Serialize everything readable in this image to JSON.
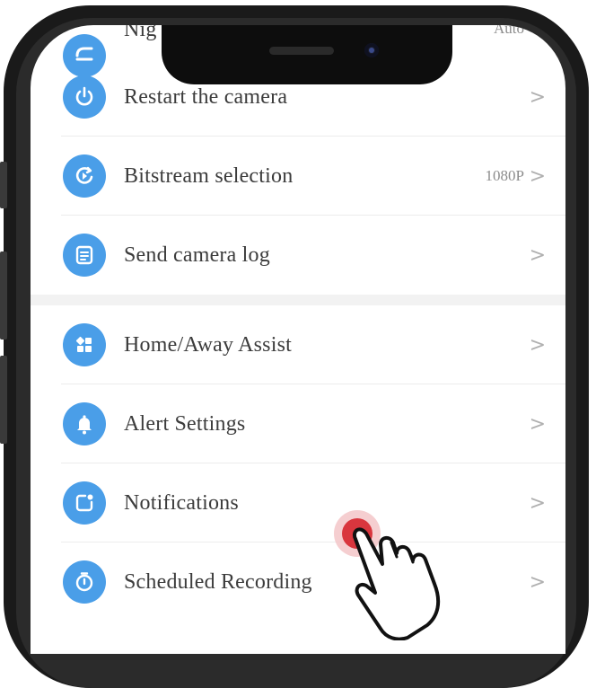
{
  "menu": {
    "items": [
      {
        "label": "Nig",
        "value": "Auto",
        "icon": "night-mode-icon"
      },
      {
        "label": "Restart the camera",
        "value": "",
        "icon": "power-icon"
      },
      {
        "label": "Bitstream selection",
        "value": "1080P",
        "icon": "bitstream-icon"
      },
      {
        "label": "Send camera log",
        "value": "",
        "icon": "log-document-icon"
      },
      {
        "label": "Home/Away Assist",
        "value": "",
        "icon": "home-away-icon"
      },
      {
        "label": "Alert Settings",
        "value": "",
        "icon": "bell-icon"
      },
      {
        "label": "Notifications",
        "value": "",
        "icon": "notification-icon"
      },
      {
        "label": "Scheduled Recording",
        "value": "",
        "icon": "timer-icon"
      }
    ],
    "chevron": ">"
  },
  "colors": {
    "icon_accent": "#4a9ee8",
    "tap_indicator": "#d9363e",
    "frame": "#1a1a1a"
  }
}
